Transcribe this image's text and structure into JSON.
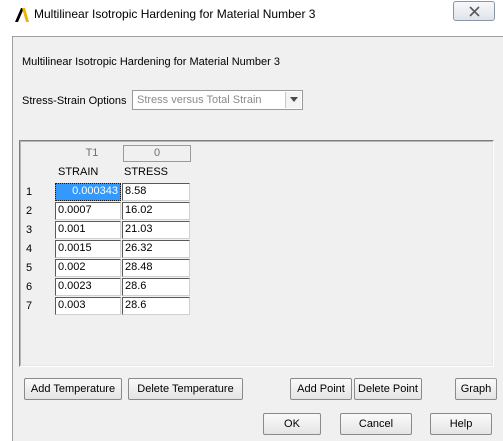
{
  "window": {
    "title": "Multilinear Isotropic Hardening for Material Number 3",
    "icon": "ansys-logo-icon",
    "close_icon": "close-icon"
  },
  "header": {
    "label": "Multilinear Isotropic Hardening for Material Number 3"
  },
  "options": {
    "label": "Stress-Strain Options",
    "selected": "Stress versus Total Strain"
  },
  "temperature": {
    "label": "T1",
    "value": "0"
  },
  "table": {
    "columns": [
      "STRAIN",
      "STRESS"
    ],
    "rows": [
      {
        "index": "1",
        "strain": "0.000343",
        "stress": "8.58"
      },
      {
        "index": "2",
        "strain": "0.0007",
        "stress": "16.02"
      },
      {
        "index": "3",
        "strain": "0.001",
        "stress": "21.03"
      },
      {
        "index": "4",
        "strain": "0.0015",
        "stress": "26.32"
      },
      {
        "index": "5",
        "strain": "0.002",
        "stress": "28.48"
      },
      {
        "index": "6",
        "strain": "0.0023",
        "stress": "28.6"
      },
      {
        "index": "7",
        "strain": "0.003",
        "stress": "28.6"
      }
    ]
  },
  "buttons": {
    "add_temperature": "Add Temperature",
    "delete_temperature": "Delete Temperature",
    "add_point": "Add Point",
    "delete_point": "Delete Point",
    "graph": "Graph",
    "ok": "OK",
    "cancel": "Cancel",
    "help": "Help"
  },
  "colors": {
    "selection": "#3399ff",
    "dialog_background": "#f0f0f0"
  }
}
